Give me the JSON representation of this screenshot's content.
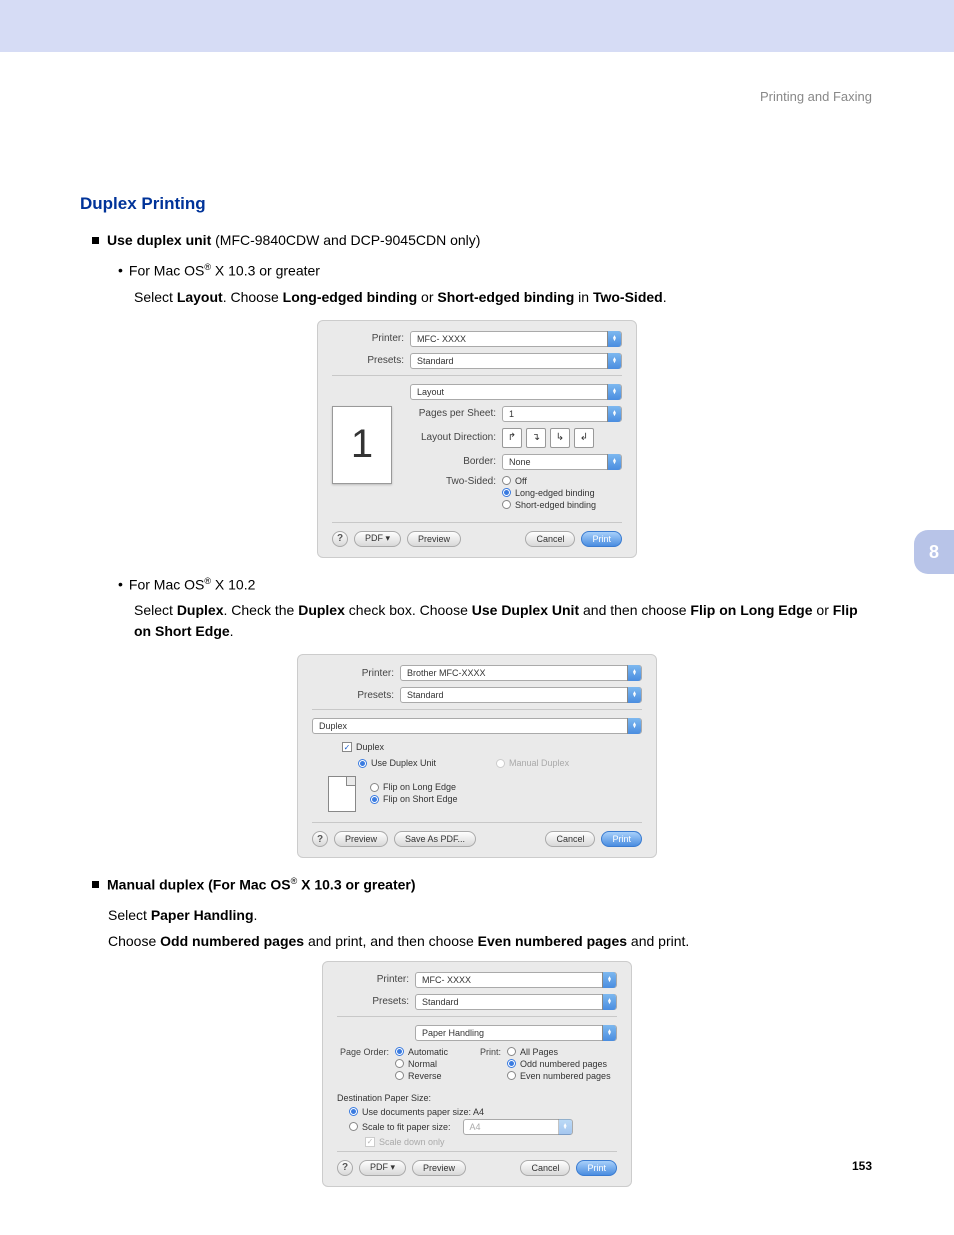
{
  "header": "Printing and Faxing",
  "chapter_tab": "8",
  "page_number": "153",
  "title": "Duplex Printing",
  "bullet1_bold": "Use duplex unit",
  "bullet1_rest": " (MFC-9840CDW and DCP-9045CDN only)",
  "sub1_prefix": "For Mac OS",
  "sub1_suffix": " X 10.3 or greater",
  "sub1_line_a": "Select ",
  "sub1_line_b": "Layout",
  "sub1_line_c": ". Choose ",
  "sub1_line_d": "Long-edged binding",
  "sub1_line_e": " or ",
  "sub1_line_f": "Short-edged binding",
  "sub1_line_g": " in ",
  "sub1_line_h": "Two-Sided",
  "sub1_line_i": ".",
  "sub2_prefix": "For Mac OS",
  "sub2_suffix": " X 10.2",
  "sub2_line_a": "Select ",
  "sub2_line_b": "Duplex",
  "sub2_line_c": ". Check the ",
  "sub2_line_d": "Duplex",
  "sub2_line_e": " check box. Choose ",
  "sub2_line_f": "Use Duplex Unit",
  "sub2_line_g": " and then choose ",
  "sub2_line_h": "Flip on Long Edge",
  "sub2_line_i": " or ",
  "sub2_line_j": "Flip on Short Edge",
  "sub2_line_k": ".",
  "bullet2_a": "Manual duplex (For Mac OS",
  "bullet2_b": " X 10.3 or greater)",
  "bullet2_sel_a": "Select ",
  "bullet2_sel_b": "Paper Handling",
  "bullet2_sel_c": ".",
  "bullet2_choose_a": "Choose ",
  "bullet2_choose_b": "Odd numbered pages",
  "bullet2_choose_c": " and print, and then choose ",
  "bullet2_choose_d": "Even numbered pages",
  "bullet2_choose_e": " and print.",
  "dlg1": {
    "printer_label": "Printer:",
    "printer_value": "MFC- XXXX",
    "presets_label": "Presets:",
    "presets_value": "Standard",
    "panel": "Layout",
    "pps_label": "Pages per Sheet:",
    "pps_value": "1",
    "ld_label": "Layout Direction:",
    "border_label": "Border:",
    "border_value": "None",
    "ts_label": "Two-Sided:",
    "ts_off": "Off",
    "ts_long": "Long-edged binding",
    "ts_short": "Short-edged binding",
    "preview_num": "1",
    "pdf_btn": "PDF ▾",
    "preview_btn": "Preview",
    "cancel_btn": "Cancel",
    "print_btn": "Print"
  },
  "dlg2": {
    "printer_label": "Printer:",
    "printer_value": "Brother MFC-XXXX",
    "presets_label": "Presets:",
    "presets_value": "Standard",
    "panel": "Duplex",
    "duplex_check": "Duplex",
    "use_unit": "Use Duplex Unit",
    "manual": "Manual Duplex",
    "flip_long": "Flip on Long Edge",
    "flip_short": "Flip on Short Edge",
    "preview_btn": "Preview",
    "saveas_btn": "Save As PDF...",
    "cancel_btn": "Cancel",
    "print_btn": "Print"
  },
  "dlg3": {
    "printer_label": "Printer:",
    "printer_value": "MFC- XXXX",
    "presets_label": "Presets:",
    "presets_value": "Standard",
    "panel": "Paper Handling",
    "po_label": "Page Order:",
    "po_auto": "Automatic",
    "po_normal": "Normal",
    "po_reverse": "Reverse",
    "print_label": "Print:",
    "print_all": "All Pages",
    "print_odd": "Odd numbered pages",
    "print_even": "Even numbered pages",
    "dest_label": "Destination Paper Size:",
    "use_doc": "Use documents paper size:  A4",
    "scale_fit": "Scale to fit paper size:",
    "scale_val": "A4",
    "scale_down": "Scale down only",
    "pdf_btn": "PDF ▾",
    "preview_btn": "Preview",
    "cancel_btn": "Cancel",
    "print_btn": "Print"
  }
}
